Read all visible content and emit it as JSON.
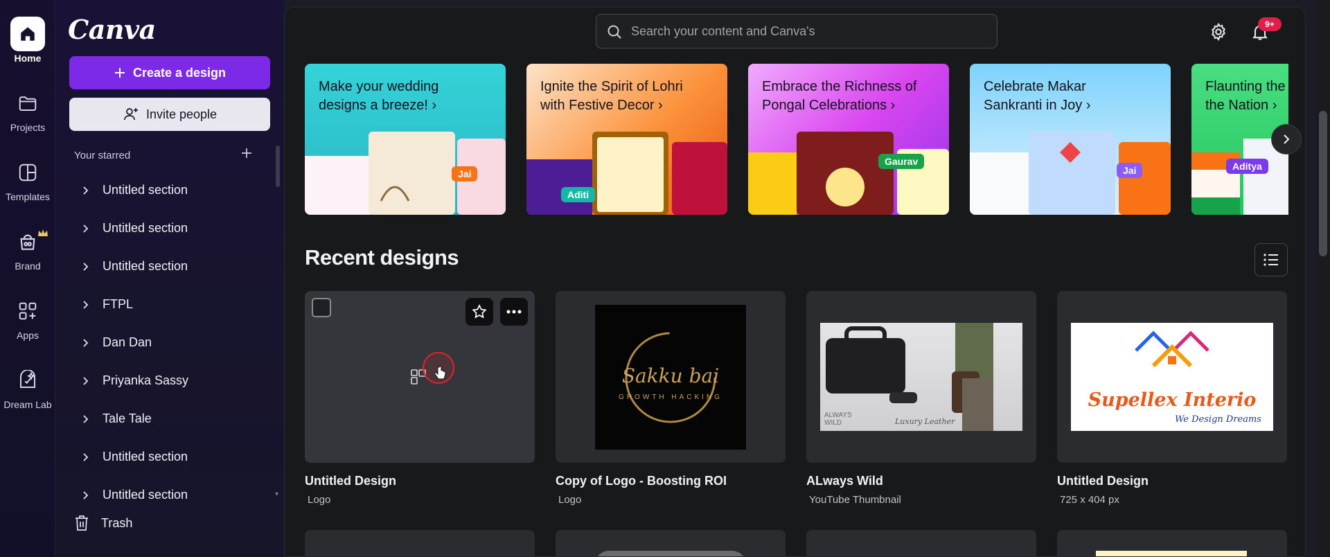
{
  "rail": {
    "items": [
      {
        "label": "Home",
        "icon": "home-icon",
        "active": true
      },
      {
        "label": "Projects",
        "icon": "folder-icon"
      },
      {
        "label": "Templates",
        "icon": "templates-icon"
      },
      {
        "label": "Brand",
        "icon": "brand-icon"
      },
      {
        "label": "Apps",
        "icon": "apps-icon"
      },
      {
        "label": "Dream Lab",
        "icon": "dream-lab-icon"
      }
    ]
  },
  "sidebar": {
    "logo": "Canva",
    "create_label": "Create a design",
    "invite_label": "Invite people",
    "starred_heading": "Your starred",
    "sections": [
      "Untitled section",
      "Untitled section",
      "Untitled section",
      "FTPL",
      "Dan Dan",
      "Priyanka Sassy",
      "Tale Tale",
      "Untitled section",
      "Untitled section"
    ],
    "trash_label": "Trash"
  },
  "topbar": {
    "search_placeholder": "Search your content and Canva's",
    "notification_count": "9+"
  },
  "banners": [
    {
      "line1": "Make your wedding",
      "line2": "designs a breeze! ›",
      "tag": "Jai",
      "tag_color": "#f97316"
    },
    {
      "line1": "Ignite the Spirit of Lohri",
      "line2": "with Festive Decor ›",
      "tag": "Aditi",
      "tag_color": "#14b8a6"
    },
    {
      "line1": "Embrace the Richness of",
      "line2": "Pongal Celebrations ›",
      "tag": "Gaurav",
      "tag_color": "#16a34a"
    },
    {
      "line1": "Celebrate Makar",
      "line2": "Sankranti in Joy ›",
      "tag": "Jai",
      "tag_color": "#8b5cf6"
    },
    {
      "line1": "Flaunting the",
      "line2": "the Nation ›",
      "tag": "Aditya",
      "tag_color": "#7c3aed"
    }
  ],
  "recent": {
    "title": "Recent designs",
    "cards": [
      {
        "title": "Untitled Design",
        "subtitle": "Logo"
      },
      {
        "title": "Copy of Logo - Boosting ROI",
        "subtitle": "Logo",
        "art_text": "Sakku bai",
        "art_sub": "GROWTH HACKING"
      },
      {
        "title": "ALways Wild",
        "subtitle": "YouTube Thumbnail",
        "art_text": "ALWAYS WILD",
        "art_sub": "Luxury Leather"
      },
      {
        "title": "Untitled Design",
        "subtitle": "725 x 404 px",
        "art_text": "Supellex Interio",
        "art_sub": "We Design Dreams"
      }
    ]
  },
  "colors": {
    "accent": "#7d2ae8",
    "badge": "#e11d48",
    "rail_bg": "#160f2e",
    "main_bg": "#18191b",
    "card_bg": "#2b2c30"
  }
}
